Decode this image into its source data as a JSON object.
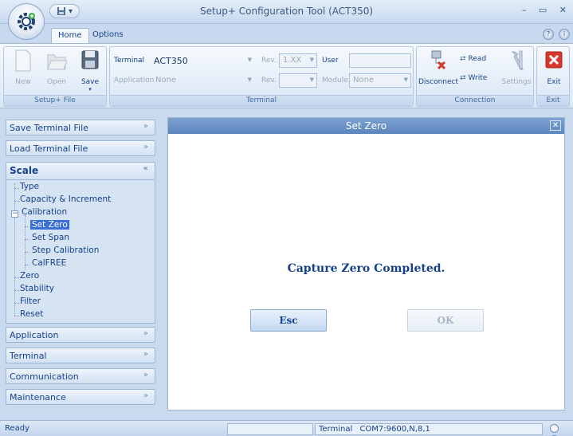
{
  "window": {
    "title": "Setup+ Configuration Tool (ACT350)",
    "controls": "– ▭ ✕"
  },
  "ribbon_tabs": [
    "Home",
    "Options"
  ],
  "ribbon": {
    "setup_file": {
      "label": "Setup+ File",
      "buttons": [
        {
          "label": "New",
          "enabled": false
        },
        {
          "label": "Open",
          "enabled": false
        },
        {
          "label": "Save",
          "enabled": true
        }
      ]
    },
    "terminal": {
      "label": "Terminal",
      "terminal_label": "Terminal",
      "terminal_value": "ACT350",
      "rev1_label": "Rev.",
      "rev1_value": "1.XX",
      "user_label": "User",
      "user_value": "",
      "application_label": "Application",
      "application_value": "None",
      "rev2_label": "Rev.",
      "rev2_value": "",
      "module_label": "Module",
      "module_value": "None"
    },
    "connection": {
      "label": "Connection",
      "disconnect": "Disconnect",
      "read": "Read",
      "write": "Write",
      "settings": "Settings"
    },
    "exit": {
      "label": "Exit",
      "button": "Exit"
    }
  },
  "sidebar": {
    "save_terminal_file": "Save Terminal File",
    "load_terminal_file": "Load Terminal File",
    "scale": "Scale",
    "tree": {
      "type": "Type",
      "capacity": "Capacity & Increment",
      "calibration": "Calibration",
      "set_zero": "Set Zero",
      "set_span": "Set Span",
      "step_calibration": "Step Calibration",
      "calfree": "CalFREE",
      "zero": "Zero",
      "stability": "Stability",
      "filter": "Filter",
      "reset": "Reset"
    },
    "application": "Application",
    "terminal": "Terminal",
    "communication": "Communication",
    "maintenance": "Maintenance"
  },
  "panel": {
    "title": "Set Zero",
    "message": "Capture Zero Completed.",
    "esc_label": "Esc",
    "ok_label": "OK"
  },
  "statusbar": {
    "status": "Ready",
    "terminal_label": "Terminal",
    "port": "COM7:9600,N,8,1"
  },
  "colors": {
    "accent": "#15428b",
    "panel_header": "#6a93c8",
    "selection": "#3a6fd8",
    "exit_red": "#d9382c"
  }
}
